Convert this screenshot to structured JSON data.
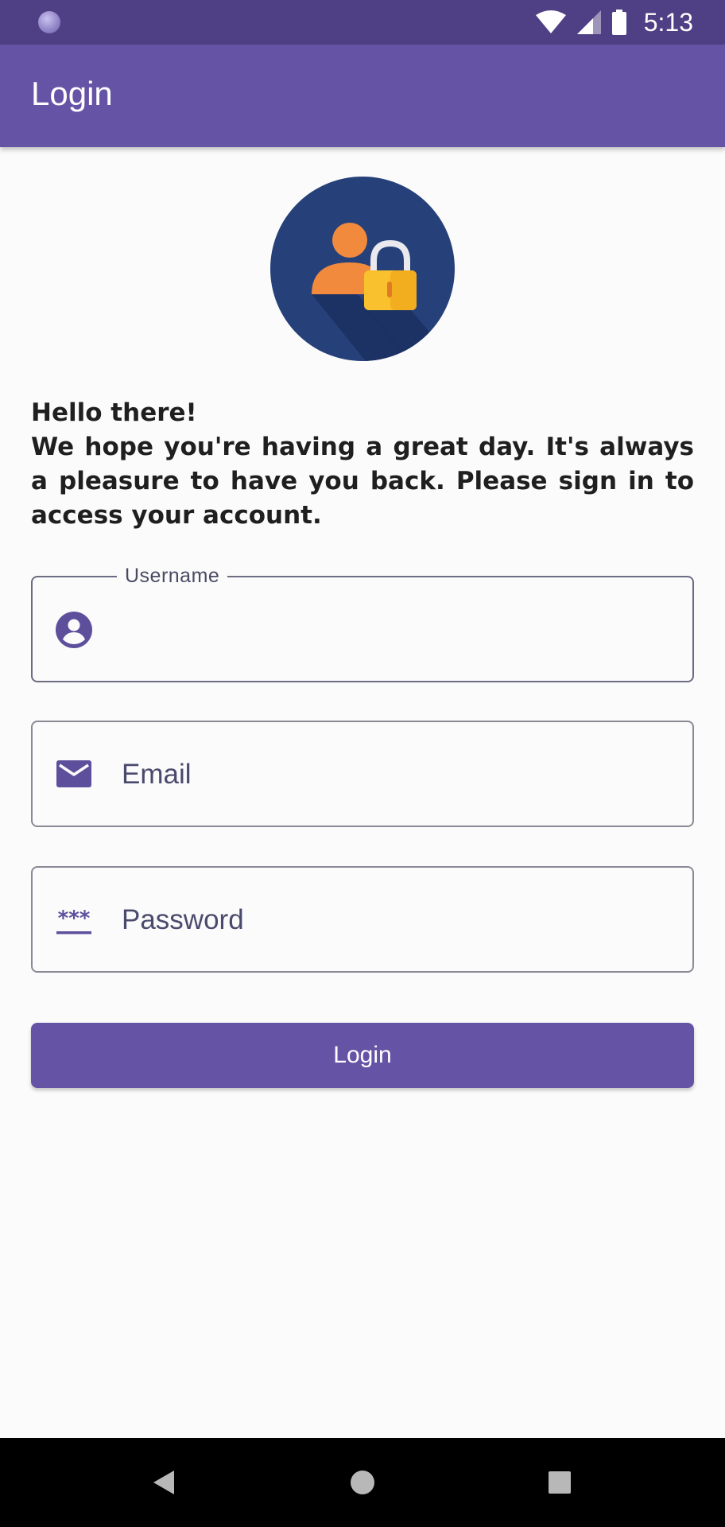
{
  "status_bar": {
    "time": "5:13",
    "icons": [
      "notification-dot-icon",
      "wifi-icon",
      "signal-icon",
      "battery-icon"
    ]
  },
  "app_bar": {
    "title": "Login"
  },
  "greeting": {
    "title": "Hello there!",
    "body": "We hope you're having a great day. It's always a pleasure to have you back. Please sign in to access your account."
  },
  "form": {
    "username": {
      "label": "Username",
      "value": "",
      "placeholder": "",
      "icon": "account-circle-icon"
    },
    "email": {
      "label": "",
      "value": "",
      "placeholder": "Email",
      "icon": "mail-icon"
    },
    "password": {
      "label": "",
      "value": "",
      "placeholder": "Password",
      "icon": "password-icon"
    },
    "login_label": "Login"
  },
  "nav": {
    "icons": [
      "back-icon",
      "home-icon",
      "recents-icon"
    ]
  },
  "colors": {
    "status_bar": "#4f3f84",
    "primary": "#6554a6",
    "background": "#fbfbfb",
    "icon": "#5e4f9c"
  }
}
